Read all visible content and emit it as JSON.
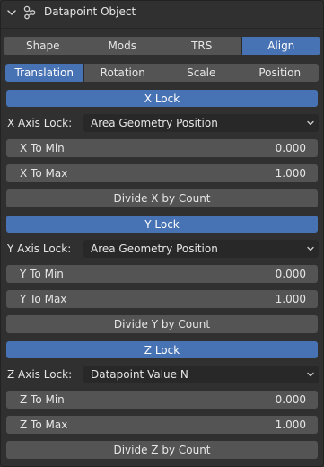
{
  "header": {
    "title": "Datapoint Object",
    "collapse_icon": "chevron-down-icon",
    "object_icon": "object-nodes-icon"
  },
  "top_tabs": [
    {
      "label": "Shape",
      "active": false
    },
    {
      "label": "Mods",
      "active": false
    },
    {
      "label": "TRS",
      "active": false
    },
    {
      "label": "Align",
      "active": true
    }
  ],
  "sub_tabs": [
    {
      "label": "Translation",
      "active": true
    },
    {
      "label": "Rotation",
      "active": false
    },
    {
      "label": "Scale",
      "active": false
    },
    {
      "label": "Position",
      "active": false
    }
  ],
  "x_section": {
    "header": "X Lock",
    "lock_label": "X Axis Lock:",
    "lock_value": "Area Geometry Position",
    "min_label": "X To Min",
    "min_value": "0.000",
    "max_label": "X To Max",
    "max_value": "1.000",
    "divide_label": "Divide X by Count"
  },
  "y_section": {
    "header": "Y Lock",
    "lock_label": "Y Axis Lock:",
    "lock_value": "Area Geometry Position",
    "min_label": "Y To Min",
    "min_value": "0.000",
    "max_label": "Y To Max",
    "max_value": "1.000",
    "divide_label": "Divide Y by Count"
  },
  "z_section": {
    "header": "Z Lock",
    "lock_label": "Z Axis Lock:",
    "lock_value": "Datapoint Value N",
    "min_label": "Z To Min",
    "min_value": "0.000",
    "max_label": "Z To Max",
    "max_value": "1.000",
    "divide_label": "Divide Z by Count"
  },
  "colors": {
    "accent": "#4772b3",
    "field": "#545454",
    "dropdown": "#282828",
    "background": "#303030"
  }
}
